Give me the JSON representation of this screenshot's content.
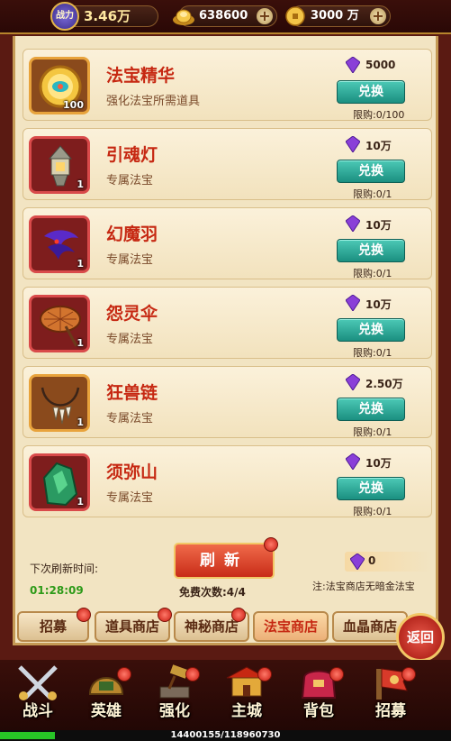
{
  "topbar": {
    "power_badge": "战力",
    "power_value": "3.46万",
    "gold_value": "638600",
    "coin_value": "3000 万"
  },
  "items": [
    {
      "name": "法宝精华",
      "desc": "强化法宝所需道具",
      "qty": "100",
      "price": "5000",
      "button": "兑换",
      "limit": "限购:0/100",
      "icon": "treasure-essence-icon"
    },
    {
      "name": "引魂灯",
      "desc": "专属法宝",
      "qty": "1",
      "price": "10万",
      "button": "兑换",
      "limit": "限购:0/1",
      "icon": "soul-lantern-icon"
    },
    {
      "name": "幻魔羽",
      "desc": "专属法宝",
      "qty": "1",
      "price": "10万",
      "button": "兑换",
      "limit": "限购:0/1",
      "icon": "demon-feather-icon"
    },
    {
      "name": "怨灵伞",
      "desc": "专属法宝",
      "qty": "1",
      "price": "10万",
      "button": "兑换",
      "limit": "限购:0/1",
      "icon": "spirit-umbrella-icon"
    },
    {
      "name": "狂兽链",
      "desc": "专属法宝",
      "qty": "1",
      "price": "2.50万",
      "button": "兑换",
      "limit": "限购:0/1",
      "icon": "beast-necklace-icon"
    },
    {
      "name": "须弥山",
      "desc": "专属法宝",
      "qty": "1",
      "price": "10万",
      "button": "兑换",
      "limit": "限购:0/1",
      "icon": "jade-mountain-icon"
    }
  ],
  "refresh": {
    "label": "下次刷新时间:",
    "time": "01:28:09",
    "button": "刷新",
    "free_count": "免费次数:4/4",
    "gem_balance": "0",
    "note": "注:法宝商店无暗金法宝"
  },
  "tabs": [
    "招募",
    "道具商店",
    "神秘商店",
    "法宝商店",
    "血晶商店"
  ],
  "return_label": "返回",
  "nav": [
    "战斗",
    "英雄",
    "强化",
    "主城",
    "背包",
    "招募"
  ],
  "exp": {
    "text": "14400155/118960730",
    "progress": 0.121
  },
  "colors": {
    "exchange_button": "#2aa896",
    "item_name": "#c62812",
    "gem": "#8a3fd8"
  }
}
